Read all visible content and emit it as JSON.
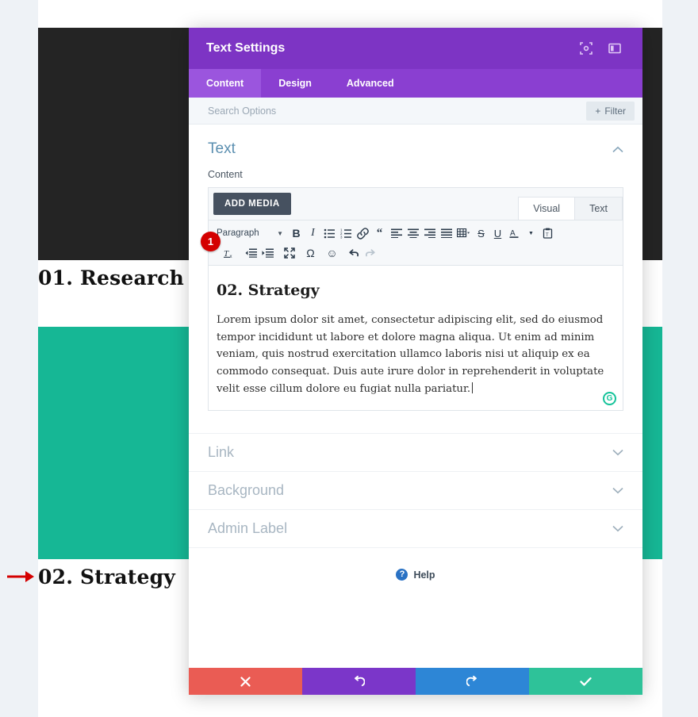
{
  "background_page": {
    "heading_1": "01. Research",
    "heading_2": "02. Strategy",
    "dark_block_color": "#242424",
    "teal_block_color": "#16b795",
    "annotation_arrow": "red-arrow-right"
  },
  "annotations": {
    "badge_1": "1"
  },
  "modal": {
    "title": "Text Settings",
    "header_icons": [
      {
        "name": "expand-fullscreen-icon"
      },
      {
        "name": "split-view-icon"
      }
    ],
    "tabs": [
      {
        "label": "Content",
        "active": true
      },
      {
        "label": "Design",
        "active": false
      },
      {
        "label": "Advanced",
        "active": false
      }
    ],
    "search": {
      "placeholder": "Search Options",
      "value": ""
    },
    "filter_button": {
      "label": "Filter",
      "icon": "plus-icon"
    },
    "section": {
      "title": "Text",
      "collapse_icon": "chevron-up-icon",
      "field_label": "Content",
      "add_media_label": "ADD MEDIA",
      "editor_tabs": [
        {
          "label": "Visual",
          "active": true
        },
        {
          "label": "Text",
          "active": false
        }
      ],
      "toolbar": {
        "format_select": "Paragraph",
        "row1": [
          {
            "name": "bold-icon",
            "glyph": "B"
          },
          {
            "name": "italic-icon",
            "glyph": "I"
          },
          {
            "name": "bulleted-list-icon",
            "glyph": ""
          },
          {
            "name": "numbered-list-icon",
            "glyph": ""
          },
          {
            "name": "link-icon",
            "glyph": ""
          },
          {
            "name": "blockquote-icon",
            "glyph": "“"
          },
          {
            "name": "align-left-icon",
            "glyph": ""
          },
          {
            "name": "align-center-icon",
            "glyph": ""
          },
          {
            "name": "align-right-icon",
            "glyph": ""
          },
          {
            "name": "align-justify-icon",
            "glyph": ""
          },
          {
            "name": "table-icon",
            "glyph": ""
          },
          {
            "name": "strikethrough-icon",
            "glyph": "S"
          },
          {
            "name": "underline-icon",
            "glyph": "U"
          },
          {
            "name": "text-color-icon",
            "glyph": "A"
          },
          {
            "name": "paste-as-text-icon",
            "glyph": ""
          }
        ],
        "row2": [
          {
            "name": "clear-formatting-icon",
            "glyph": ""
          },
          {
            "name": "outdent-icon",
            "glyph": ""
          },
          {
            "name": "indent-icon",
            "glyph": ""
          },
          {
            "name": "fullscreen-icon",
            "glyph": ""
          },
          {
            "name": "special-character-icon",
            "glyph": "Ω"
          },
          {
            "name": "emoji-icon",
            "glyph": "☺"
          },
          {
            "name": "undo-icon",
            "glyph": ""
          },
          {
            "name": "redo-icon",
            "glyph": ""
          }
        ]
      },
      "document": {
        "heading": "02. Strategy",
        "paragraph": "Lorem ipsum dolor sit amet, consectetur adipiscing elit, sed do eiusmod tempor incididunt ut labore et dolore magna aliqua. Ut enim ad minim veniam, quis nostrud exercitation ullamco laboris nisi ut aliquip ex ea commodo consequat. Duis aute irure dolor in reprehenderit in voluptate velit esse cillum dolore eu fugiat nulla pariatur."
      },
      "grammarly_badge": "G"
    },
    "accordions": [
      {
        "label": "Link",
        "icon": "chevron-down-icon"
      },
      {
        "label": "Background",
        "icon": "chevron-down-icon"
      },
      {
        "label": "Admin Label",
        "icon": "chevron-down-icon"
      }
    ],
    "help": {
      "icon_glyph": "?",
      "label": "Help"
    },
    "footer_buttons": [
      {
        "name": "cancel-button",
        "icon": "close-x-icon",
        "glyph": "✖",
        "color": "#ea5c54"
      },
      {
        "name": "undo-button",
        "icon": "undo-icon",
        "glyph": "↺",
        "color": "#7b36c9"
      },
      {
        "name": "redo-button",
        "icon": "redo-icon",
        "glyph": "↻",
        "color": "#2d86d6"
      },
      {
        "name": "save-button",
        "icon": "checkmark-icon",
        "glyph": "✔",
        "color": "#2ec299"
      }
    ]
  }
}
